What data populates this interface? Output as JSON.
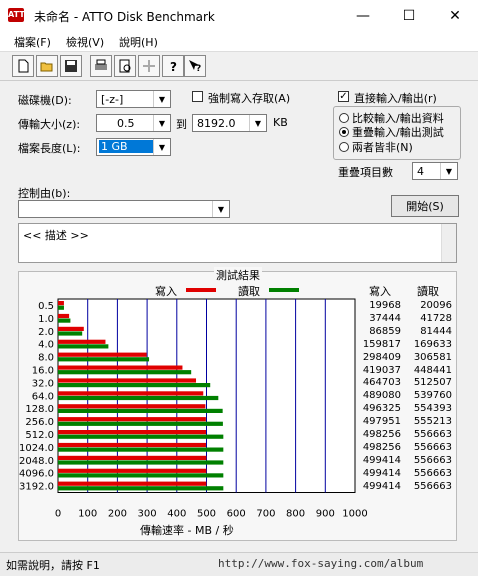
{
  "window": {
    "title": "未命名 - ATTO Disk Benchmark",
    "app_icon": "ATTO",
    "minimize_icon": "—",
    "maximize_icon": "☐",
    "close_icon": "✕"
  },
  "menu": [
    "檔案(F)",
    "檢視(V)",
    "說明(H)"
  ],
  "toolbar_icons": [
    "new-file-icon",
    "open-folder-icon",
    "save-icon",
    "print-icon",
    "print-preview-icon",
    "move-icon",
    "help-icon",
    "context-help-icon"
  ],
  "settings": {
    "drive_label": "磁碟機(D):",
    "drive_value": "[-z-]",
    "transfer_label": "傳輸大小(z):",
    "transfer_from": "0.5",
    "to_label": "到",
    "transfer_to": "8192.0",
    "kb_label": "KB",
    "length_label": "檔案長度(L):",
    "length_value": "1 GB",
    "force_write_label": "強制寫入存取(A)",
    "direct_io_label": "直接輸入/輸出(r)",
    "direct_io_checked": true,
    "radio_options": [
      "比較輸入/輸出資料",
      "重疊輸入/輸出測試",
      "兩者皆非(N)"
    ],
    "radio_selected": 1,
    "queue_label": "重疊項目數",
    "queue_value": "4",
    "controlled_label": "控制由(b):",
    "controlled_value": "",
    "start_button": "開始(S)",
    "description": "<<    描述    >>"
  },
  "results": {
    "title": "測試結果",
    "write_legend": "寫入",
    "read_legend": "讀取",
    "col_write": "寫入",
    "col_read": "讀取",
    "rows": [
      {
        "size": "0.5",
        "write": "19968",
        "read": "20096"
      },
      {
        "size": "1.0",
        "write": "37444",
        "read": "41728"
      },
      {
        "size": "2.0",
        "write": "86859",
        "read": "81444"
      },
      {
        "size": "4.0",
        "write": "159817",
        "read": "169633"
      },
      {
        "size": "8.0",
        "write": "298409",
        "read": "306581"
      },
      {
        "size": "16.0",
        "write": "419037",
        "read": "448441"
      },
      {
        "size": "32.0",
        "write": "464703",
        "read": "512507"
      },
      {
        "size": "64.0",
        "write": "489080",
        "read": "539760"
      },
      {
        "size": "128.0",
        "write": "496325",
        "read": "554393"
      },
      {
        "size": "256.0",
        "write": "497951",
        "read": "555213"
      },
      {
        "size": "512.0",
        "write": "498256",
        "read": "556663"
      },
      {
        "size": "1024.0",
        "write": "498256",
        "read": "556663"
      },
      {
        "size": "2048.0",
        "write": "499414",
        "read": "556663"
      },
      {
        "size": "4096.0",
        "write": "499414",
        "read": "556663"
      },
      {
        "size": "3192.0",
        "write": "499414",
        "read": "556663"
      }
    ],
    "xlabel": "傳輸速率 - MB / 秒"
  },
  "chart_data": {
    "type": "bar",
    "categories": [
      "0.5",
      "1.0",
      "2.0",
      "4.0",
      "8.0",
      "16.0",
      "32.0",
      "64.0",
      "128.0",
      "256.0",
      "512.0",
      "1024.0",
      "2048.0",
      "4096.0",
      "3192.0"
    ],
    "series": [
      {
        "name": "寫入",
        "color": "#e00000",
        "values": [
          19.968,
          37.444,
          86.859,
          159.817,
          298.409,
          419.037,
          464.703,
          489.08,
          496.325,
          497.951,
          498.256,
          498.256,
          499.414,
          499.414,
          499.414
        ]
      },
      {
        "name": "讀取",
        "color": "#008000",
        "values": [
          20.096,
          41.728,
          81.444,
          169.633,
          306.581,
          448.441,
          512.507,
          539.76,
          554.393,
          555.213,
          556.663,
          556.663,
          556.663,
          556.663,
          556.663
        ]
      }
    ],
    "xticks": [
      "0",
      "100",
      "200",
      "300",
      "400",
      "500",
      "600",
      "700",
      "800",
      "900",
      "1000"
    ],
    "xlim": [
      0,
      1000
    ],
    "orientation": "horizontal",
    "grid": true,
    "gridline_color": "#0000a0"
  },
  "status": {
    "text": "如需說明，請按 F1",
    "watermark": "http://www.fox-saying.com/album"
  }
}
